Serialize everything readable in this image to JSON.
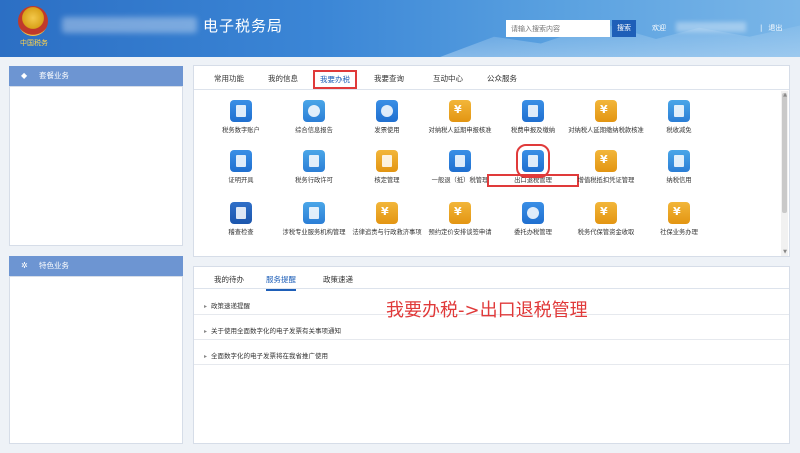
{
  "header": {
    "title": "电子税务局",
    "emblem_text": "中国税务",
    "search_placeholder": "请输入搜索内容",
    "search_button": "搜索",
    "welcome": "欢迎",
    "logout": "退出",
    "separator": "|"
  },
  "sidebar": {
    "package_header": "套餐业务",
    "feature_header": "特色业务"
  },
  "top_tabs": [
    {
      "label": "常用功能"
    },
    {
      "label": "我的信息"
    },
    {
      "label": "我要办税",
      "active": true
    },
    {
      "label": "我要查询"
    },
    {
      "label": "互动中心"
    },
    {
      "label": "公众服务"
    }
  ],
  "services": [
    {
      "label": "税务数字账户",
      "icon": "account-icon"
    },
    {
      "label": "综合信息报告",
      "icon": "user-report-icon"
    },
    {
      "label": "发票使用",
      "icon": "invoice-user-icon"
    },
    {
      "label": "对纳税人延期申报核准",
      "icon": "deferred-filing-icon"
    },
    {
      "label": "税费申报及缴纳",
      "icon": "tax-filing-icon"
    },
    {
      "label": "对纳税人延期缴纳税款核准",
      "icon": "deferred-payment-icon"
    },
    {
      "label": "税收减免",
      "icon": "tax-reduction-icon"
    },
    {
      "label": "证明开具",
      "icon": "certificate-icon"
    },
    {
      "label": "税务行政许可",
      "icon": "admin-permit-icon"
    },
    {
      "label": "核定管理",
      "icon": "assessment-icon"
    },
    {
      "label": "一般退（抵）税管理",
      "icon": "refund-icon"
    },
    {
      "label": "出口退税管理",
      "icon": "export-refund-icon",
      "highlighted": true
    },
    {
      "label": "增值税抵扣凭证管理",
      "icon": "vat-deduction-icon"
    },
    {
      "label": "纳税信用",
      "icon": "tax-credit-icon"
    },
    {
      "label": "稽查检查",
      "icon": "inspection-icon"
    },
    {
      "label": "涉税专业服务机构管理",
      "icon": "agency-icon"
    },
    {
      "label": "法律追责与行政救济事项",
      "icon": "legal-icon"
    },
    {
      "label": "预约定价安排谈签申请",
      "icon": "pricing-icon"
    },
    {
      "label": "委托办税管理",
      "icon": "entrust-icon"
    },
    {
      "label": "税务代保管资金收取",
      "icon": "custody-icon"
    },
    {
      "label": "社保业务办理",
      "icon": "social-security-icon"
    }
  ],
  "bottom_tabs": [
    {
      "label": "我的待办"
    },
    {
      "label": "服务提醒",
      "active": true
    },
    {
      "label": "政策速递"
    }
  ],
  "notices": [
    {
      "label": "政策速递提醒"
    },
    {
      "label": "关于使用全面数字化的电子发票有关事项通知"
    },
    {
      "label": "全面数字化的电子发票将在我省推广使用"
    }
  ],
  "annotation": "我要办税->出口退税管理",
  "colors": {
    "header_blue": "#2c6fc4",
    "sidebar_header": "#6d95d2",
    "accent_blue": "#1e5fb8",
    "highlight_red": "#e03a3a"
  }
}
